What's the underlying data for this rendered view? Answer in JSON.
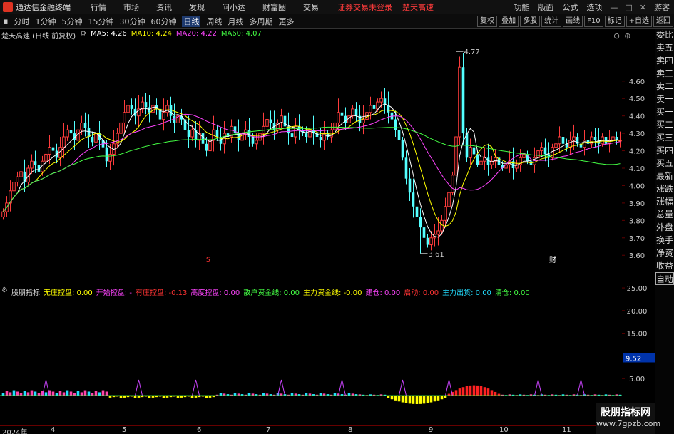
{
  "app": {
    "title": "通达信金融终端"
  },
  "menu": [
    "行情",
    "市场",
    "资讯",
    "发现",
    "问小达",
    "财富圈",
    "交易"
  ],
  "notice": {
    "login": "证券交易未登录",
    "stock": "楚天高速"
  },
  "menu_right": [
    "功能",
    "版面",
    "公式",
    "选项"
  ],
  "user": "游客",
  "periods": [
    "分时",
    "1分钟",
    "5分钟",
    "15分钟",
    "30分钟",
    "60分钟",
    "日线",
    "周线",
    "月线",
    "多周期",
    "更多"
  ],
  "active_period": "日线",
  "tools": [
    "复权",
    "叠加",
    "多股",
    "统计",
    "画线",
    "F10",
    "标记",
    "+自选",
    "返回"
  ],
  "sidebar": [
    "委比",
    "卖五",
    "卖四",
    "卖三",
    "卖二",
    "卖一",
    "买一",
    "买二",
    "买三",
    "买四",
    "买五",
    "最新",
    "涨跌",
    "涨幅",
    "总量",
    "外盘",
    "换手",
    "净资",
    "收益",
    "自动"
  ],
  "main": {
    "stock_label": "楚天高速 (日线 前复权)",
    "ma": [
      {
        "label": "MA5: 4.26",
        "color": "#ffffff"
      },
      {
        "label": "MA10: 4.24",
        "color": "#ffff00"
      },
      {
        "label": "MA20: 4.22",
        "color": "#ff44ff"
      },
      {
        "label": "MA60: 4.07",
        "color": "#44ff44"
      }
    ],
    "high_label": "4.77",
    "low_label": "3.61",
    "marker_s": "S",
    "marker_cai": "财"
  },
  "sub": {
    "name": "股朋指标",
    "items": [
      {
        "label": "无庄控盘: 0.00",
        "color": "#ffff00"
      },
      {
        "label": "开始控盘: -",
        "color": "#ff44ff"
      },
      {
        "label": "有庄控盘: -0.13",
        "color": "#ff3333"
      },
      {
        "label": "高度控盘: 0.00",
        "color": "#ff44ff"
      },
      {
        "label": "散户资金线: 0.00",
        "color": "#44ff44"
      },
      {
        "label": "主力资金线: -0.00",
        "color": "#ffff00"
      },
      {
        "label": "建仓: 0.00",
        "color": "#ff44ff"
      },
      {
        "label": "启动: 0.00",
        "color": "#ff3333"
      },
      {
        "label": "主力出货: 0.00",
        "color": "#22ddff"
      },
      {
        "label": "清仓: 0.00",
        "color": "#44ff44"
      }
    ],
    "current_value": "9.52"
  },
  "xaxis": [
    {
      "label": "2024年",
      "x": 0
    },
    {
      "label": "4",
      "x": 68
    },
    {
      "label": "5",
      "x": 168
    },
    {
      "label": "6",
      "x": 273
    },
    {
      "label": "7",
      "x": 370
    },
    {
      "label": "8",
      "x": 485
    },
    {
      "label": "9",
      "x": 598
    },
    {
      "label": "10",
      "x": 697
    },
    {
      "label": "11",
      "x": 785
    }
  ],
  "watermark": {
    "line1": "股朋指标网",
    "line2": "www.7gpzb.com"
  },
  "chart_data": [
    {
      "type": "line",
      "title": "楚天高速 (日线 前复权)",
      "y_ticks": [
        3.6,
        3.7,
        3.8,
        3.9,
        4.0,
        4.1,
        4.2,
        4.3,
        4.4,
        4.5,
        4.6
      ],
      "ylim": [
        3.56,
        4.82
      ],
      "n": 176,
      "closes": [
        3.85,
        3.9,
        3.97,
        4.02,
        4.05,
        4.08,
        4.02,
        4.1,
        4.14,
        4.12,
        4.08,
        4.14,
        4.18,
        4.22,
        4.2,
        4.16,
        4.22,
        4.28,
        4.32,
        4.3,
        4.26,
        4.32,
        4.36,
        4.33,
        4.28,
        4.25,
        4.3,
        4.26,
        4.22,
        4.14,
        4.18,
        4.24,
        4.3,
        4.36,
        4.42,
        4.46,
        4.44,
        4.4,
        4.44,
        4.48,
        4.45,
        4.42,
        4.46,
        4.44,
        4.38,
        4.42,
        4.46,
        4.4,
        4.36,
        4.4,
        4.38,
        4.32,
        4.28,
        4.32,
        4.26,
        4.3,
        4.24,
        4.2,
        4.26,
        4.32,
        4.28,
        4.24,
        4.3,
        4.28,
        4.34,
        4.3,
        4.26,
        4.3,
        4.32,
        4.28,
        4.24,
        4.26,
        4.3,
        4.34,
        4.38,
        4.36,
        4.32,
        4.36,
        4.4,
        4.34,
        4.3,
        4.28,
        4.34,
        4.32,
        4.3,
        4.28,
        4.32,
        4.3,
        4.28,
        4.26,
        4.3,
        4.28,
        4.32,
        4.36,
        4.42,
        4.4,
        4.36,
        4.4,
        4.44,
        4.4,
        4.36,
        4.38,
        4.42,
        4.46,
        4.44,
        4.48,
        4.5,
        4.46,
        4.42,
        4.38,
        4.32,
        4.26,
        4.16,
        4.04,
        3.96,
        3.88,
        3.82,
        3.76,
        3.7,
        3.66,
        3.7,
        3.72,
        3.74,
        3.8,
        3.88,
        3.96,
        4.06,
        4.28,
        4.68,
        4.3,
        4.16,
        4.22,
        4.18,
        4.12,
        4.14,
        4.16,
        4.12,
        4.14,
        4.16,
        4.12,
        4.1,
        4.12,
        4.14,
        4.1,
        4.12,
        4.16,
        4.18,
        4.14,
        4.12,
        4.16,
        4.2,
        4.22,
        4.18,
        4.16,
        4.22,
        4.24,
        4.28,
        4.24,
        4.22,
        4.26,
        4.28,
        4.24,
        4.22,
        4.26,
        4.24,
        4.28,
        4.26,
        4.24,
        4.28,
        4.24,
        4.26,
        4.28,
        4.26,
        4.26
      ],
      "series": [
        {
          "name": "MA5",
          "value": 4.26,
          "color": "#ffffff"
        },
        {
          "name": "MA10",
          "value": 4.24,
          "color": "#ffff00"
        },
        {
          "name": "MA20",
          "value": 4.22,
          "color": "#ff44ff"
        },
        {
          "name": "MA60",
          "value": 4.07,
          "color": "#44ff44"
        }
      ],
      "annotations": [
        {
          "label": "4.77",
          "value": 4.77
        },
        {
          "label": "3.61",
          "value": 3.61
        }
      ]
    },
    {
      "type": "bar",
      "title": "股朋指标",
      "y_ticks": [
        5.0,
        10.0,
        15.0,
        20.0,
        25.0
      ],
      "ylim": [
        0,
        28
      ],
      "current": 9.52
    }
  ],
  "colors": {
    "up": "#ff3c3c",
    "down": "#54ffff",
    "grid": "#600000"
  }
}
